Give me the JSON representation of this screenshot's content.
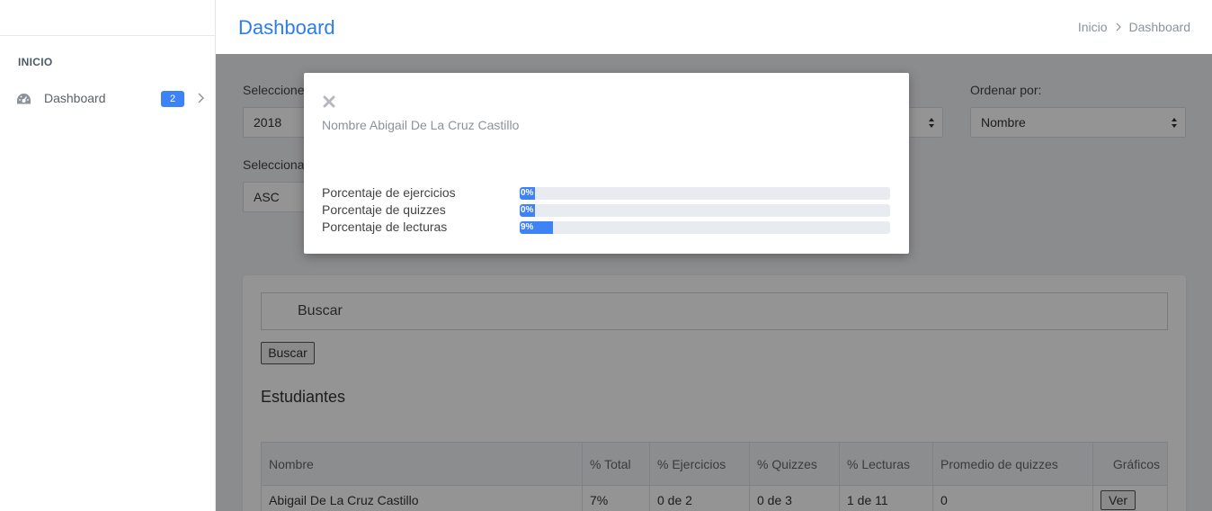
{
  "sidebar": {
    "section": "INICIO",
    "items": [
      {
        "label": "Dashboard",
        "badge": "2",
        "icon": "dashboard-icon"
      }
    ]
  },
  "header": {
    "title": "Dashboard",
    "breadcrumb": [
      "Inicio",
      "Dashboard"
    ]
  },
  "filters": {
    "year_label": "Seleccione",
    "year_value": "2018",
    "order_label": "Ordenar por:",
    "order_value": "Nombre",
    "direction_label": "Selecciona",
    "direction_value": "ASC"
  },
  "search": {
    "placeholder": "Buscar",
    "button": "Buscar"
  },
  "students": {
    "title": "Estudiantes",
    "columns": [
      "Nombre",
      "% Total",
      "% Ejercicios",
      "% Quizzes",
      "% Lecturas",
      "Promedio de quizzes",
      "Gráficos"
    ],
    "rows": [
      {
        "nombre": "Abigail De La Cruz Castillo",
        "total": "7%",
        "ejercicios": "0 de 2",
        "quizzes": "0 de 3",
        "lecturas": "1 de 11",
        "promedio": "0",
        "action": "Ver"
      }
    ]
  },
  "modal": {
    "name": "Nombre Abigail De La Cruz Castillo",
    "progress": [
      {
        "label": "Porcentaje de ejercicios",
        "percent": 0,
        "text": "0%"
      },
      {
        "label": "Porcentaje de quizzes",
        "percent": 0,
        "text": "0%"
      },
      {
        "label": "Porcentaje de lecturas",
        "percent": 9,
        "text": "9%"
      }
    ]
  },
  "colors": {
    "accent": "#3e82f7",
    "title": "#2b7de9"
  }
}
